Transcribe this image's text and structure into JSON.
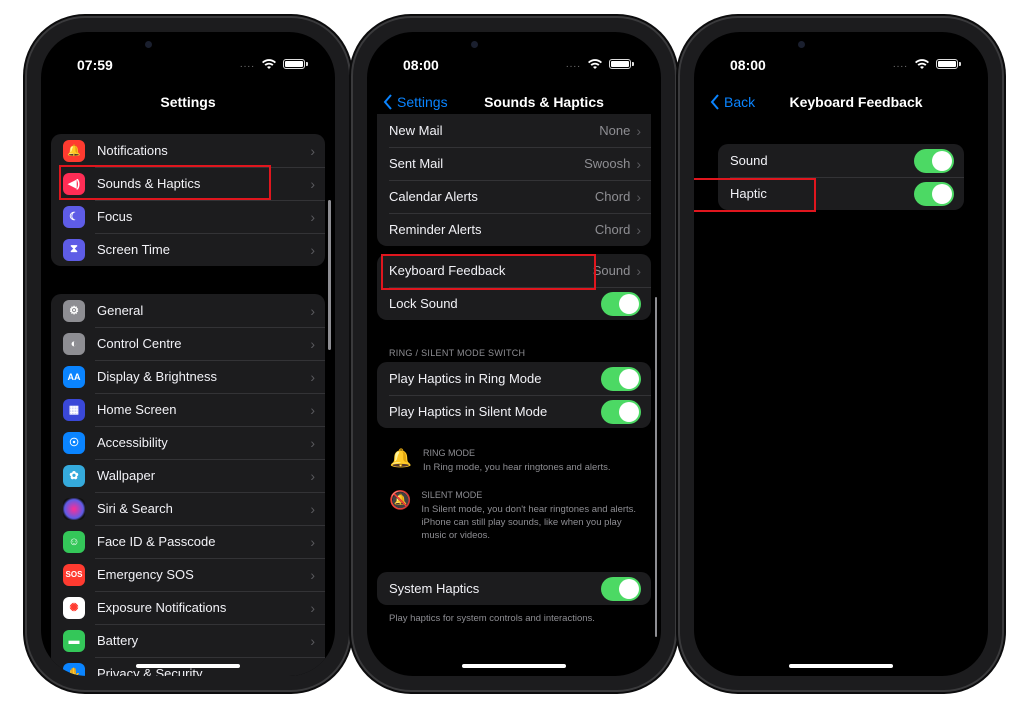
{
  "screens": {
    "settings": {
      "time": "07:59",
      "title": "Settings",
      "group1": [
        {
          "label": "Notifications",
          "icon": "bell-icon",
          "color": "#ff3b30"
        },
        {
          "label": "Sounds & Haptics",
          "icon": "speaker-icon",
          "color": "#ff2d55"
        },
        {
          "label": "Focus",
          "icon": "moon-icon",
          "color": "#5e5ce6"
        },
        {
          "label": "Screen Time",
          "icon": "hourglass-icon",
          "color": "#5e5ce6"
        }
      ],
      "group2": [
        {
          "label": "General",
          "icon": "gear-icon",
          "color": "#8e8e93"
        },
        {
          "label": "Control Centre",
          "icon": "switches-icon",
          "color": "#8e8e93"
        },
        {
          "label": "Display & Brightness",
          "icon": "text-size-icon",
          "color": "#0a84ff"
        },
        {
          "label": "Home Screen",
          "icon": "app-grid-icon",
          "color": "#3a48d8"
        },
        {
          "label": "Accessibility",
          "icon": "accessibility-icon",
          "color": "#0a84ff"
        },
        {
          "label": "Wallpaper",
          "icon": "flower-icon",
          "color": "#35aadc"
        },
        {
          "label": "Siri & Search",
          "icon": "siri-icon",
          "color": "#2c2c54"
        },
        {
          "label": "Face ID & Passcode",
          "icon": "face-id-icon",
          "color": "#34c759"
        },
        {
          "label": "Emergency SOS",
          "icon": "sos-icon",
          "color": "#ff3b30"
        },
        {
          "label": "Exposure Notifications",
          "icon": "exposure-icon",
          "color": "#ffffff"
        },
        {
          "label": "Battery",
          "icon": "battery-icon",
          "color": "#34c759"
        },
        {
          "label": "Privacy & Security",
          "icon": "hand-icon",
          "color": "#0a84ff"
        }
      ],
      "glyphs": {
        "bell": "🔔",
        "speaker": "🔊",
        "moon": "☾",
        "hourglass": "⧗",
        "gear": "⚙",
        "switches": "◐",
        "aa": "AA",
        "grid": "▦",
        "access": "♿",
        "flower": "✿",
        "siri": "◉",
        "face": "☺",
        "sos": "SOS",
        "exposure": "✺",
        "battery": "▬",
        "hand": "✋"
      }
    },
    "sounds": {
      "time": "08:00",
      "back": "Settings",
      "title": "Sounds & Haptics",
      "alerts": [
        {
          "label": "New Mail",
          "value": "None"
        },
        {
          "label": "Sent Mail",
          "value": "Swoosh"
        },
        {
          "label": "Calendar Alerts",
          "value": "Chord"
        },
        {
          "label": "Reminder Alerts",
          "value": "Chord"
        }
      ],
      "keyboard_feedback": {
        "label": "Keyboard Feedback",
        "value": "Sound"
      },
      "lock_sound": {
        "label": "Lock Sound",
        "on": true
      },
      "ring_silent_header": "RING / SILENT MODE SWITCH",
      "ring_haptics": {
        "label": "Play Haptics in Ring Mode",
        "on": true
      },
      "silent_haptics": {
        "label": "Play Haptics in Silent Mode",
        "on": true
      },
      "ring_mode": {
        "title": "RING MODE",
        "desc": "In Ring mode, you hear ringtones and alerts."
      },
      "silent_mode": {
        "title": "SILENT MODE",
        "desc": "In Silent mode, you don't hear ringtones and alerts. iPhone can still play sounds, like when you play music or videos."
      },
      "system_haptics": {
        "label": "System Haptics",
        "on": true
      },
      "system_haptics_footer": "Play haptics for system controls and interactions."
    },
    "keyboard": {
      "time": "08:00",
      "back": "Back",
      "title": "Keyboard Feedback",
      "sound": {
        "label": "Sound",
        "on": true
      },
      "haptic": {
        "label": "Haptic",
        "on": true
      }
    }
  },
  "colors": {
    "accent": "#0a84ff",
    "toggle_on": "#4cd964",
    "highlight": "#e0161e"
  }
}
